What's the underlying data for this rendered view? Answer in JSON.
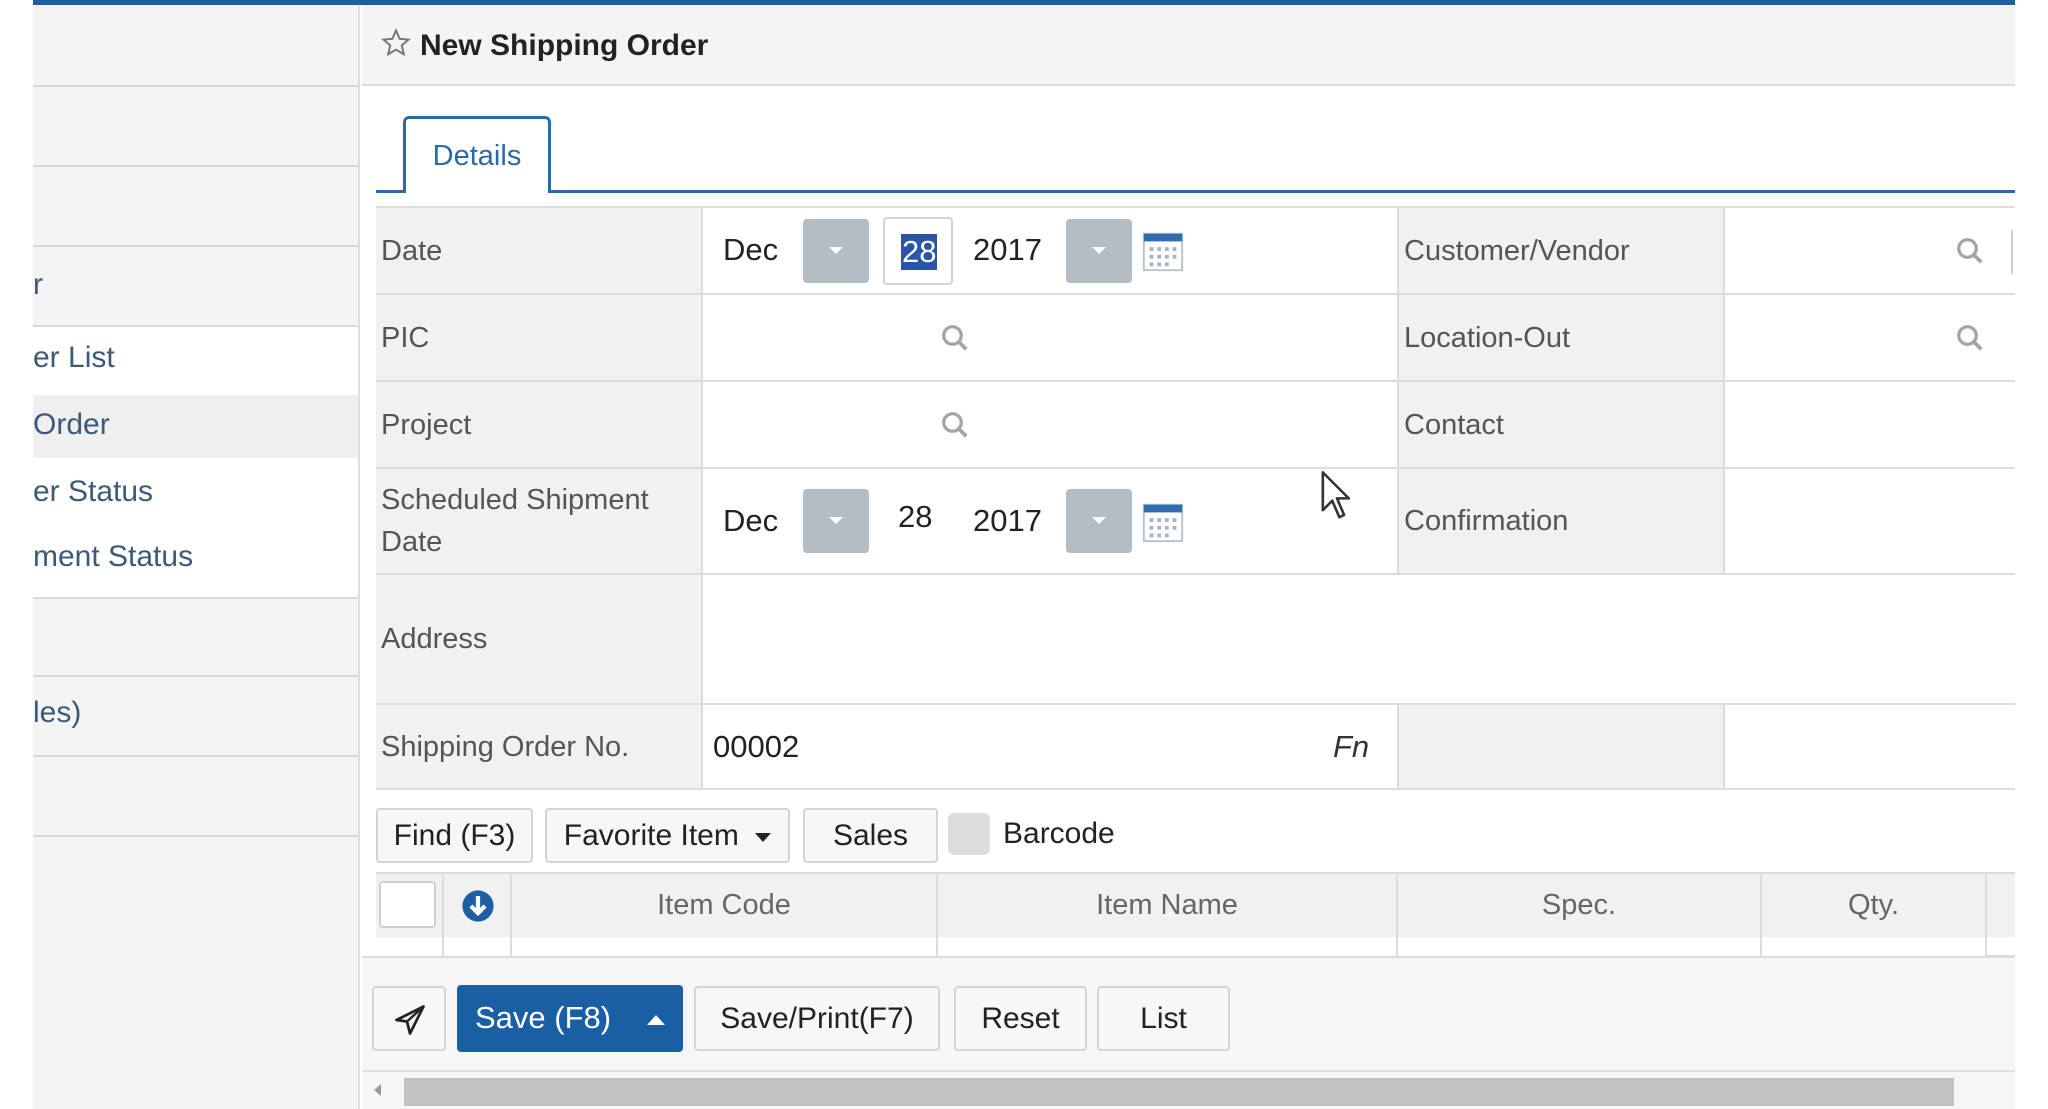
{
  "sidebar": {
    "items": [
      {
        "label": "r"
      },
      {
        "label": "er List"
      },
      {
        "label": " Order",
        "selected": true
      },
      {
        "label": "er Status"
      },
      {
        "label": "ment Status"
      },
      {
        "label": "les)"
      }
    ]
  },
  "header": {
    "title": "New Shipping Order",
    "star_icon": "star-outline-icon"
  },
  "tabs": [
    {
      "label": "Details",
      "active": true
    }
  ],
  "form": {
    "date": {
      "label": "Date",
      "month": "Dec",
      "day": "28",
      "year": "2017",
      "day_selected": true
    },
    "customer_vendor": {
      "label": "Customer/Vendor",
      "value": ""
    },
    "pic": {
      "label": "PIC",
      "value": ""
    },
    "location_out": {
      "label": "Location-Out",
      "value": ""
    },
    "project": {
      "label": "Project",
      "value": ""
    },
    "contact": {
      "label": "Contact",
      "value": ""
    },
    "scheduled_shipment_date": {
      "label": "Scheduled Shipment Date",
      "label_line1": "Scheduled Shipment",
      "label_line2": "Date",
      "month": "Dec",
      "day": "28",
      "year": "2017"
    },
    "confirmation": {
      "label": "Confirmation",
      "value": ""
    },
    "address": {
      "label": "Address",
      "value": ""
    },
    "shipping_order_no": {
      "label": "Shipping Order No.",
      "value": "00002",
      "fn_label": "Fn"
    }
  },
  "item_toolbar": {
    "find_label": "Find (F3)",
    "favorite_label": "Favorite Item",
    "sales_label": "Sales",
    "barcode_label": "Barcode",
    "barcode_checked": false
  },
  "item_table": {
    "columns": [
      "Item Code",
      "Item Name",
      "Spec.",
      "Qty."
    ],
    "rows": []
  },
  "footer": {
    "save_label": "Save (F8)",
    "save_print_label": "Save/Print(F7)",
    "reset_label": "Reset",
    "list_label": "List"
  },
  "colors": {
    "accent": "#1d5fa0",
    "tab_border": "#2c6aa6",
    "save_button": "#1a5ea4",
    "dropdown_button": "#b4bcc4",
    "label_bg": "#f1f1f1"
  }
}
